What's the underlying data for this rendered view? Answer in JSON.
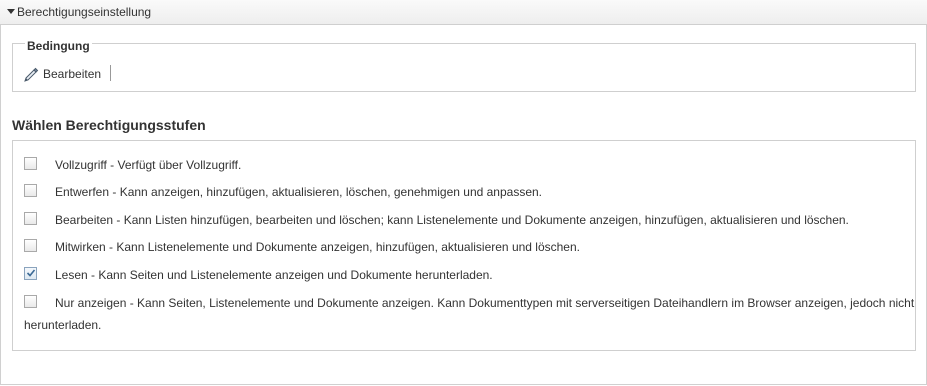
{
  "header": {
    "title": "Berechtigungseinstellung",
    "collapse_icon": "triangle-down-icon"
  },
  "condition": {
    "legend": "Bedingung",
    "edit_label": "Bearbeiten",
    "edit_icon": "pencil-icon"
  },
  "levels": {
    "title": "Wählen Berechtigungsstufen",
    "items": [
      {
        "label": "Vollzugriff - Verfügt über Vollzugriff.",
        "checked": false
      },
      {
        "label": "Entwerfen - Kann anzeigen, hinzufügen, aktualisieren, löschen, genehmigen und anpassen.",
        "checked": false
      },
      {
        "label": "Bearbeiten - Kann Listen hinzufügen, bearbeiten und löschen; kann Listenelemente und Dokumente anzeigen, hinzufügen, aktualisieren und löschen.",
        "checked": false
      },
      {
        "label": "Mitwirken - Kann Listenelemente und Dokumente anzeigen, hinzufügen, aktualisieren und löschen.",
        "checked": false
      },
      {
        "label": "Lesen - Kann Seiten und Listenelemente anzeigen und Dokumente herunterladen.",
        "checked": true
      },
      {
        "label": "Nur anzeigen - Kann Seiten, Listenelemente und Dokumente anzeigen. Kann Dokumenttypen mit serverseitigen Dateihandlern im Browser anzeigen, jedoch nicht",
        "label_cont": "herunterladen.",
        "checked": false
      }
    ]
  }
}
